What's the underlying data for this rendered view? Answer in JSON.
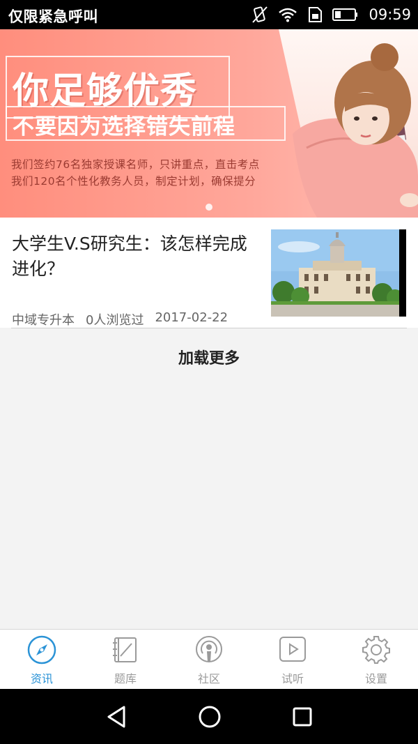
{
  "status_bar": {
    "carrier": "仅限紧急呼叫",
    "time": "09:59",
    "icons": [
      "vibrate-icon",
      "wifi-icon",
      "sim-icon",
      "battery-icon"
    ]
  },
  "banner": {
    "headline": "你足够优秀",
    "subline": "不要因为选择错失前程",
    "desc_line1": "我们签约76名独家授课名师，只讲重点，直击考点",
    "desc_line2": "我们120名个性化教务人员，制定计划，确保提分",
    "active_slide": 1,
    "slide_count": 1
  },
  "news": [
    {
      "title": "大学生V.S研究生：该怎样完成进化？",
      "source": "中域专升本",
      "views": "0人浏览过",
      "date": "2017-02-22",
      "thumbnail_icon": "building-photo"
    }
  ],
  "load_more": "加载更多",
  "tabs": [
    {
      "label": "资讯",
      "icon": "compass-icon",
      "active": true
    },
    {
      "label": "题库",
      "icon": "notebook-icon",
      "active": false
    },
    {
      "label": "社区",
      "icon": "podcast-icon",
      "active": false
    },
    {
      "label": "试听",
      "icon": "play-icon",
      "active": false
    },
    {
      "label": "设置",
      "icon": "gear-icon",
      "active": false
    }
  ],
  "colors": {
    "accent": "#2b93d6",
    "tab_inactive": "#9a9a9a",
    "banner_bg": "#ff9a8b"
  },
  "nav": [
    "back-icon",
    "home-icon",
    "recents-icon"
  ]
}
